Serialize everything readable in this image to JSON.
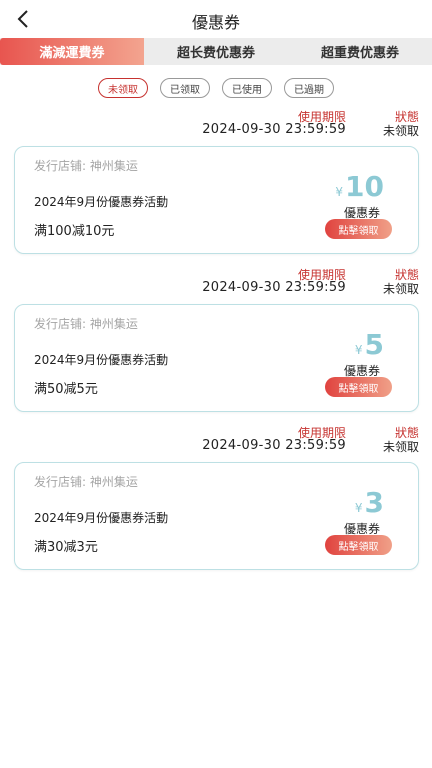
{
  "header": {
    "title": "優惠券"
  },
  "tabs": [
    "滿減運費券",
    "超长费优惠券",
    "超重费优惠券"
  ],
  "filters": [
    "未领取",
    "已领取",
    "已使用",
    "已過期"
  ],
  "list_labels": {
    "period": "使用期限",
    "status": "狀態"
  },
  "coupons": [
    {
      "expiry": "2024-09-30 23:59:59",
      "status": "未领取",
      "store": "发行店铺:  神州集运",
      "activity": "2024年9月份優惠券活動",
      "rule": "满100减10元",
      "currency": "¥",
      "amount": "10",
      "type": "優惠券",
      "claim": "點擊領取"
    },
    {
      "expiry": "2024-09-30 23:59:59",
      "status": "未领取",
      "store": "发行店铺:  神州集运",
      "activity": "2024年9月份優惠券活動",
      "rule": "满50减5元",
      "currency": "¥",
      "amount": "5",
      "type": "優惠券",
      "claim": "點擊領取"
    },
    {
      "expiry": "2024-09-30 23:59:59",
      "status": "未领取",
      "store": "发行店铺:  神州集运",
      "activity": "2024年9月份優惠券活動",
      "rule": "满30减3元",
      "currency": "¥",
      "amount": "3",
      "type": "優惠券",
      "claim": "點擊領取"
    }
  ]
}
